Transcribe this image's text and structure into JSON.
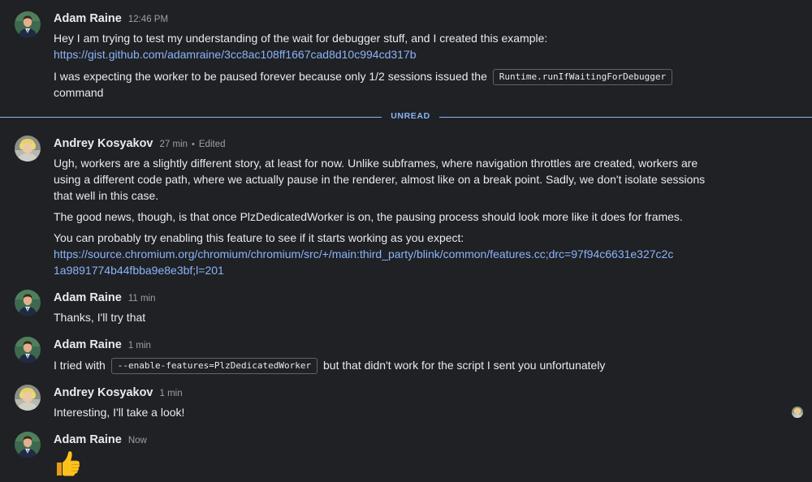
{
  "messages": [
    {
      "author": "Adam Raine",
      "time": "12:46 PM",
      "lines": [
        "Hey I am trying to test my understanding of the wait for debugger stuff, and I created this example:",
        "https://gist.github.com/adamraine/3cc8ac108ff1667cad8d10c994cd317b",
        "I was expecting the worker to be paused forever because only 1/2 sessions issued the",
        "Runtime.runIfWaitingForDebugger",
        "command"
      ]
    },
    {
      "author": "Andrey Kosyakov",
      "time": "27 min",
      "edited": "Edited",
      "lines": [
        "Ugh, workers are a slightly different story, at least for now. Unlike subframes, where navigation throttles are created, workers are",
        "using a different code path, where we actually pause in the renderer, almost like on a break point. Sadly, we don't isolate sessions",
        "that well in this case.",
        "The good news, though, is that once PlzDedicatedWorker is on, the pausing process should look more like it does for frames.",
        "You can probably try enabling this feature to see if it starts working as you expect:",
        "https://source.chromium.org/chromium/chromium/src/+/main:third_party/blink/common/features.cc;drc=97f94c6631e327c2c",
        "1a9891774b44fbba9e8e3bf;l=201"
      ]
    },
    {
      "author": "Adam Raine",
      "time": "11 min",
      "lines": [
        "Thanks, I'll try that"
      ]
    },
    {
      "author": "Adam Raine",
      "time": "1 min",
      "lines": [
        "I tried with",
        "--enable-features=PlzDedicatedWorker",
        "but that didn't work for the script I sent you unfortunately"
      ]
    },
    {
      "author": "Andrey Kosyakov",
      "time": "1 min",
      "lines": [
        "Interesting, I'll take a look!"
      ]
    },
    {
      "author": "Adam Raine",
      "time": "Now",
      "emoji": "thumbs-up"
    }
  ],
  "divider": {
    "label": "UNREAD"
  },
  "colors": {
    "background": "#202124",
    "accent": "#8ab4f8",
    "text": "#e8eaed",
    "muted": "#9aa0a6"
  }
}
